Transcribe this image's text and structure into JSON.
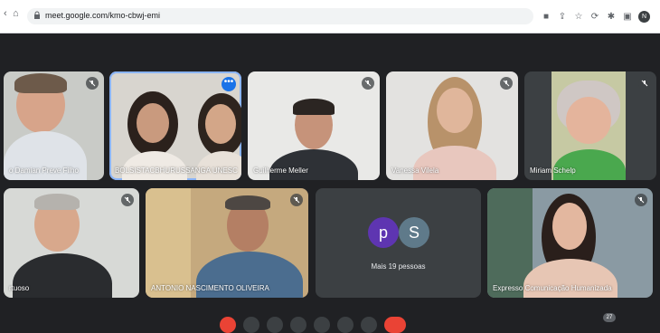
{
  "browser": {
    "url": "meet.google.com/kmo-cbwj-emi",
    "profile_initial": "N",
    "icons": [
      "back-icon",
      "home-icon",
      "lock-icon",
      "camera-icon",
      "share-icon",
      "star-icon",
      "extension-icon",
      "pin-icon",
      "sidepanel-icon",
      "profile-icon",
      "menu-icon"
    ]
  },
  "participants": [
    {
      "name": "o Damian Preve Filho",
      "muted": true
    },
    {
      "name": "BOLSISTACBHURUSSANGA UNESC",
      "muted": false,
      "active": true
    },
    {
      "name": "Guilherme Meller",
      "muted": true
    },
    {
      "name": "Vanessa Vilela",
      "muted": true
    },
    {
      "name": "Miriam Schelp",
      "muted": true
    },
    {
      "name": "rtuoso",
      "muted": true
    },
    {
      "name": "ANTONIO NASCIMENTO OLIVEIRA",
      "muted": true
    },
    {
      "name": "Expresso Comunicação Humanizada",
      "muted": true
    }
  ],
  "overflow": {
    "avatars": [
      {
        "letter": "p",
        "color": "#5e35b1"
      },
      {
        "letter": "S",
        "color": "#5f7a8a"
      }
    ],
    "label": "Mais 19 pessoas"
  },
  "controls": {
    "participants_count": "27"
  }
}
